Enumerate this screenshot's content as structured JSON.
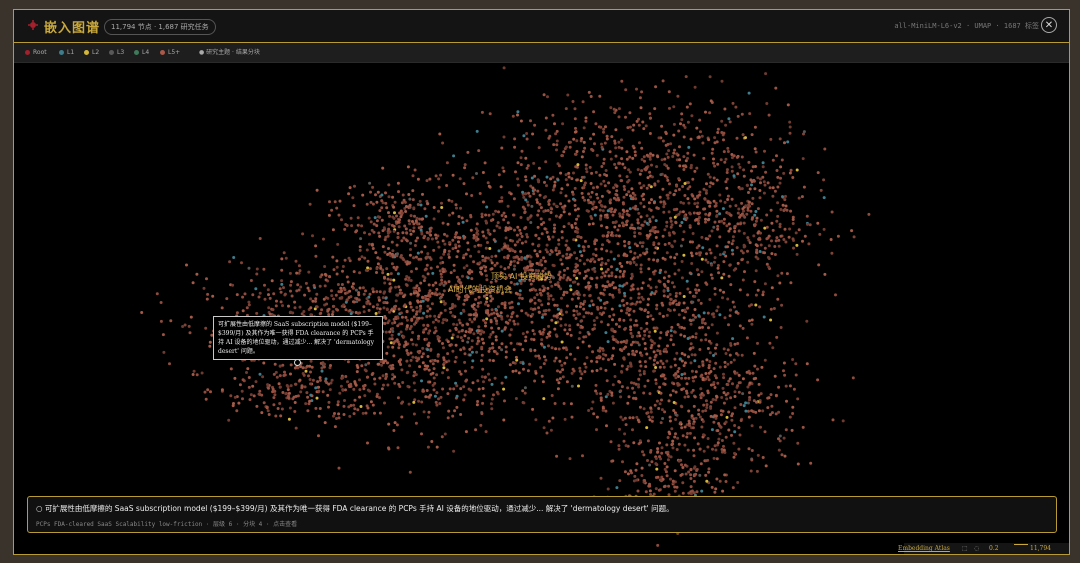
{
  "header": {
    "title": "嵌入图谱",
    "stats": "11,794 节点 · 1,687 研究任务",
    "model_info": "all-MiniLM-L6-v2 · UMAP · 1687 标签",
    "close_symbol": "✕"
  },
  "legend": {
    "items": [
      {
        "label": "Root",
        "color": "#a3202c"
      },
      {
        "label": "L1",
        "color": "#3d7d8c"
      },
      {
        "label": "L2",
        "color": "#d4b73a"
      },
      {
        "label": "L3",
        "color": "#595959"
      },
      {
        "label": "L4",
        "color": "#3f7a5a"
      },
      {
        "label": "L5+",
        "color": "#a8594a"
      }
    ],
    "extra": "● 研究主题 · 结果分块"
  },
  "plot": {
    "labels": [
      "顶尖 AI 投资趋势",
      "AI时代的投资机会"
    ]
  },
  "tooltip": {
    "text": "可扩展性由低摩擦的 SaaS subscription model ($199–$399/月) 及其作为唯一获得 FDA clearance 的 PCPs 手持 AI 设备的地位驱动，通过减少... 解决了 'dermatology desert' 问题。"
  },
  "info_panel": {
    "title": "○ 可扩展性由低摩擦的 SaaS subscription model ($199–$399/月) 及其作为唯一获得 FDA clearance 的 PCPs 手持 AI 设备的地位驱动，通过减少... 解决了 'dermatology desert' 问题。",
    "meta": "PCPs FDA-cleared SaaS Scalability low-friction · 层级 6 · 分块 4 · 点击查看"
  },
  "footer": {
    "brand": "Embedding Atlas",
    "zoom": "0.2",
    "points": "11,794 points"
  }
}
